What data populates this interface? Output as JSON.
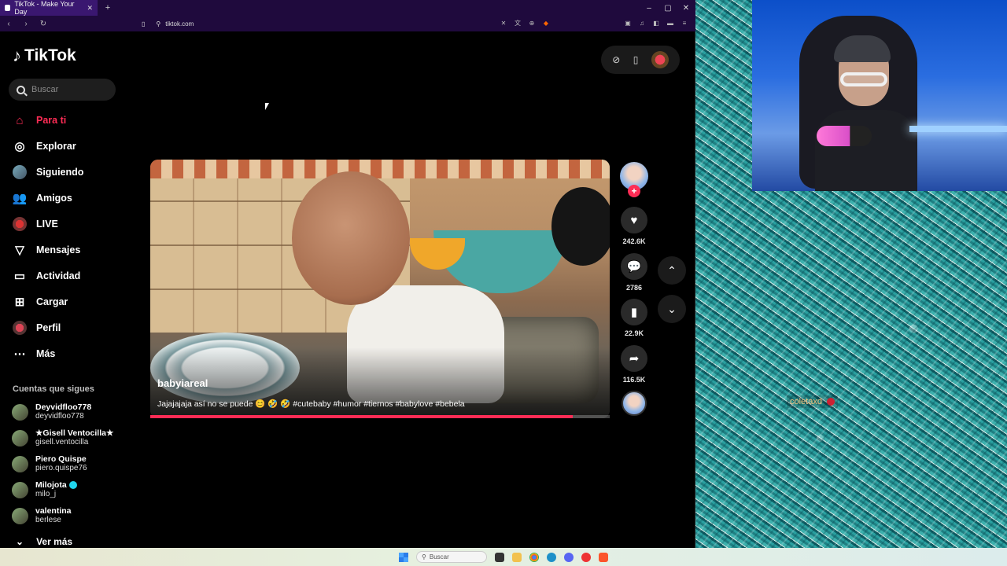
{
  "browser": {
    "tab_title": "TikTok - Make Your Day",
    "url": "tiktok.com"
  },
  "app": {
    "logo": "TikTok",
    "search_placeholder": "Buscar"
  },
  "nav": [
    {
      "label": "Para ti",
      "icon": "home-icon",
      "active": true
    },
    {
      "label": "Explorar",
      "icon": "compass-icon"
    },
    {
      "label": "Siguiendo",
      "icon": "following-avatar-icon"
    },
    {
      "label": "Amigos",
      "icon": "friends-icon"
    },
    {
      "label": "LIVE",
      "icon": "live-icon"
    },
    {
      "label": "Mensajes",
      "icon": "messages-icon"
    },
    {
      "label": "Actividad",
      "icon": "activity-icon"
    },
    {
      "label": "Cargar",
      "icon": "upload-icon"
    },
    {
      "label": "Perfil",
      "icon": "profile-icon"
    },
    {
      "label": "Más",
      "icon": "more-icon"
    }
  ],
  "following": {
    "title": "Cuentas que sigues",
    "accounts": [
      {
        "name": "Deyvidfloo778",
        "handle": "deyvidfloo778"
      },
      {
        "name": "★Gisell Ventocilla★",
        "handle": "gisell.ventocilla"
      },
      {
        "name": "Piero Quispe",
        "handle": "piero.quispe76"
      },
      {
        "name": "Milojota",
        "handle": "milo_j",
        "verified": true
      },
      {
        "name": "valentina",
        "handle": "berlese"
      }
    ],
    "see_more": "Ver más"
  },
  "video": {
    "author": "babyiareal",
    "caption": "Jajajajaja así no se puede 😊 🤣 🤣 #cutebaby #humor #tiernos #babylove #bebela",
    "progress": 0.92
  },
  "actions": {
    "likes": "242.6K",
    "comments": "2786",
    "saves": "22.9K",
    "shares": "116.5K"
  },
  "stream_overlay": {
    "username": "coletaxd"
  },
  "taskbar": {
    "search_placeholder": "Buscar"
  },
  "colors": {
    "accent": "#fe2c55",
    "browser_chrome": "#1f0a3d"
  }
}
